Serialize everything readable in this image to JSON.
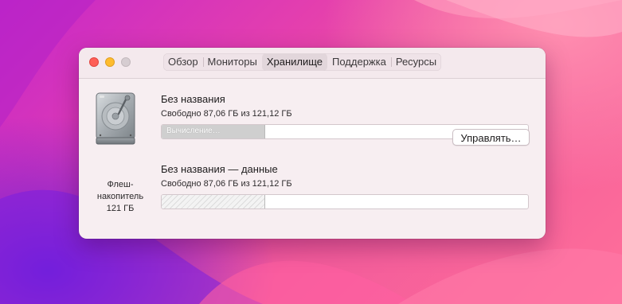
{
  "window": {
    "tabs": [
      {
        "label": "Обзор"
      },
      {
        "label": "Мониторы"
      },
      {
        "label": "Хранилище"
      },
      {
        "label": "Поддержка"
      },
      {
        "label": "Ресурсы"
      }
    ],
    "active_tab": "Хранилище"
  },
  "device": {
    "icon": "external-drive-icon",
    "label_line1": "Флеш-",
    "label_line2": "накопитель",
    "label_line3": "121 ГБ"
  },
  "volumes": [
    {
      "name": "Без названия",
      "free_text": "Свободно 87,06 ГБ из 121,12 ГБ",
      "bar_status": "Вычисление…",
      "used_fraction": 0.28
    },
    {
      "name": "Без названия — данные",
      "free_text": "Свободно 87,06 ГБ из 121,12 ГБ",
      "used_fraction": 0.28
    }
  ],
  "manage_button": {
    "label": "Управлять…"
  },
  "colors": {
    "close": "#fe5f57",
    "minimize": "#febc2e",
    "zoom_disabled": "#d6cdd1"
  }
}
